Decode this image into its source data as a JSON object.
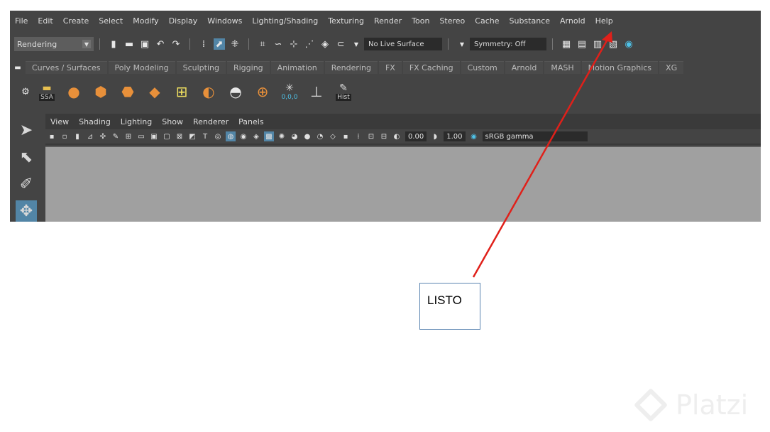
{
  "menubar": [
    "File",
    "Edit",
    "Create",
    "Select",
    "Modify",
    "Display",
    "Windows",
    "Lighting/Shading",
    "Texturing",
    "Render",
    "Toon",
    "Stereo",
    "Cache",
    "Substance",
    "Arnold",
    "Help"
  ],
  "statusline": {
    "mode": "Rendering",
    "live_surface": "No Live Surface",
    "symmetry": "Symmetry: Off"
  },
  "shelf_tabs": [
    "Curves / Surfaces",
    "Poly Modeling",
    "Sculpting",
    "Rigging",
    "Animation",
    "Rendering",
    "FX",
    "FX Caching",
    "Custom",
    "Arnold",
    "MASH",
    "Motion Graphics",
    "XG"
  ],
  "shelf_labels": {
    "ssa": "SSA",
    "coords": "0,0,0",
    "hist": "Hist"
  },
  "panel_menu": [
    "View",
    "Shading",
    "Lighting",
    "Show",
    "Renderer",
    "Panels"
  ],
  "panel_toolbar": {
    "exposure": "0.00",
    "gamma": "1.00",
    "colorspace": "sRGB gamma"
  },
  "callout": {
    "text": "LISTO"
  },
  "watermark": {
    "text": "Platzi"
  },
  "colors": {
    "arrow": "#e0201a",
    "accent": "#5285a6",
    "callout_border": "#5b84b1"
  }
}
